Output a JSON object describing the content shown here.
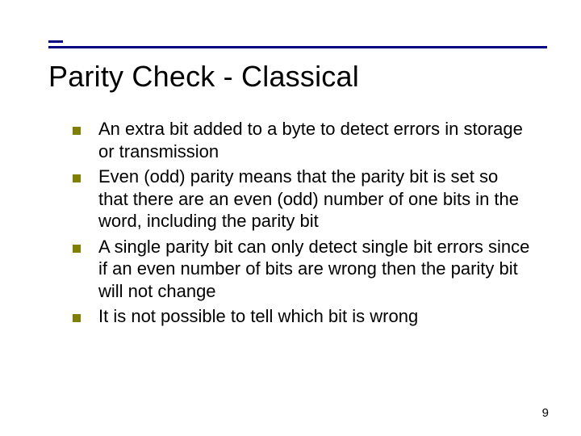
{
  "title": "Parity Check - Classical",
  "bullets": [
    "An extra bit added to a byte to detect errors in storage or transmission",
    "Even (odd) parity means that the parity bit is set so that there are an even (odd) number of one bits in the word, including the parity bit",
    "A single parity bit can only detect single bit errors since if an even number of bits are wrong then the parity bit will not change",
    "It is not possible to tell which bit is wrong"
  ],
  "page_number": "9",
  "colors": {
    "rule": "#000080",
    "bullet": "#808000"
  }
}
